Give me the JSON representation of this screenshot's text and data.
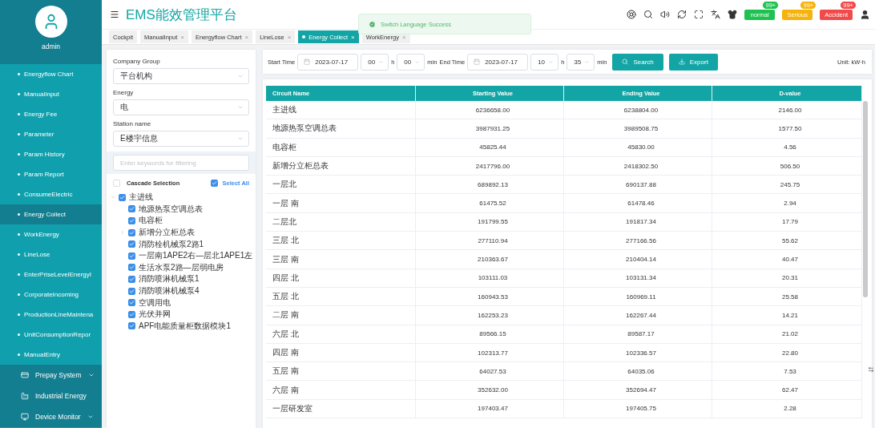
{
  "app": {
    "title": "EMS能效管理平台",
    "user": "admin"
  },
  "header": {
    "alarms": [
      {
        "label": "normal",
        "count": "99+",
        "color": "#1fc151"
      },
      {
        "label": "Serious",
        "count": "99+",
        "color": "#f5b30b"
      },
      {
        "label": "Accident",
        "count": "99+",
        "color": "#f04a4a"
      }
    ]
  },
  "tabs": [
    {
      "label": "Cockpit",
      "selected": false
    },
    {
      "label": "ManualInput",
      "close": "×",
      "selected": false
    },
    {
      "label": "Energyflow Chart",
      "close": "×",
      "selected": false
    },
    {
      "label": "LineLose",
      "close": "×",
      "selected": false
    },
    {
      "label": "Energy Collect",
      "close": "×",
      "selected": true
    },
    {
      "label": "WorkEnergy",
      "close": "×",
      "selected": false
    }
  ],
  "toast": {
    "message": "Switch Language Success"
  },
  "sidebar": {
    "items": [
      {
        "label": "Energyflow Chart",
        "selected": false
      },
      {
        "label": "ManualInput",
        "selected": false
      },
      {
        "label": "Energy Fee",
        "selected": false
      },
      {
        "label": "Parameter",
        "selected": false
      },
      {
        "label": "Param History",
        "selected": false
      },
      {
        "label": "Param Report",
        "selected": false
      },
      {
        "label": "ConsumeElectric",
        "selected": false
      },
      {
        "label": "Energy Collect",
        "selected": true
      },
      {
        "label": "WorkEnergy",
        "selected": false
      },
      {
        "label": "LineLose",
        "selected": false
      },
      {
        "label": "EnterPriseLevelEnergyI",
        "selected": false
      },
      {
        "label": "CorporateIncoming",
        "selected": false
      },
      {
        "label": "ProductionLineMaintena",
        "selected": false
      },
      {
        "label": "UnitConsumptionRepor",
        "selected": false
      },
      {
        "label": "ManualEntry",
        "selected": false
      }
    ],
    "groups": [
      {
        "label": "Prepay System",
        "kind": "expandable"
      },
      {
        "label": "Industrial Energy",
        "kind": "plain"
      },
      {
        "label": "Device Monitor",
        "kind": "expandable"
      }
    ]
  },
  "filters": {
    "company_group": {
      "label": "Company Group",
      "value": "平台机构"
    },
    "energy": {
      "label": "Energy",
      "value": "电"
    },
    "station": {
      "label": "Station name",
      "value": "E楼宇信息"
    },
    "search": {
      "placeholder": "Enter keywords for filtering"
    },
    "cascade": {
      "label": "Cascade Selection",
      "checked": false
    },
    "select_all": {
      "label": "Select All",
      "checked": true
    }
  },
  "tree": [
    {
      "label": "主进线",
      "checked": true,
      "expanded": true,
      "children": [
        {
          "label": "地源热泵空调总表",
          "checked": true
        },
        {
          "label": "电容柜",
          "checked": true
        },
        {
          "label": "新增分立柜总表",
          "checked": true,
          "expanded": false
        },
        {
          "label": "消防栓机械泵2路1",
          "checked": true
        },
        {
          "label": "一层南1APE2右—层北1APE1左",
          "checked": true
        },
        {
          "label": "生活水泵2路—层弱电房",
          "checked": true
        },
        {
          "label": "消防喷淋机械泵1",
          "checked": true
        },
        {
          "label": "消防喷淋机械泵4",
          "checked": true
        },
        {
          "label": "空调用电",
          "checked": true
        },
        {
          "label": "光伏并网",
          "checked": true
        },
        {
          "label": "APF电能质量柜数据模块1",
          "checked": true
        }
      ]
    }
  ],
  "query": {
    "start_label": "Start Time",
    "start_date": "2023-07-17",
    "start_hour": "00",
    "h1": "h",
    "start_min": "00",
    "min1": "min",
    "end_label": "End Time",
    "end_date": "2023-07-17",
    "end_hour": "10",
    "h2": "h",
    "end_min": "35",
    "min2": "min",
    "search_button": "Search",
    "export_button": "Export",
    "unit": "Unit:  kW·h"
  },
  "table": {
    "columns": [
      "Circuit Name",
      "Starting Value",
      "Ending Value",
      "D-value"
    ],
    "rows": [
      [
        "主进线",
        "6236658.00",
        "6238804.00",
        "2146.00"
      ],
      [
        "地源热泵空调总表",
        "3987931.25",
        "3989508.75",
        "1577.50"
      ],
      [
        "电容柜",
        "45825.44",
        "45830.00",
        "4.56"
      ],
      [
        "新增分立柜总表",
        "2417796.00",
        "2418302.50",
        "506.50"
      ],
      [
        "一层北",
        "689892.13",
        "690137.88",
        "245.75"
      ],
      [
        "一层 南",
        "61475.52",
        "61478.46",
        "2.94"
      ],
      [
        "二层北",
        "191799.55",
        "191817.34",
        "17.79"
      ],
      [
        "三层 北",
        "277110.94",
        "277166.56",
        "55.62"
      ],
      [
        "三层 南",
        "210363.67",
        "210404.14",
        "40.47"
      ],
      [
        "四层 北",
        "103111.03",
        "103131.34",
        "20.31"
      ],
      [
        "五层 北",
        "160943.53",
        "160969.11",
        "25.58"
      ],
      [
        "二层 南",
        "162253.23",
        "162267.44",
        "14.21"
      ],
      [
        "六层 北",
        "89566.15",
        "89587.17",
        "21.02"
      ],
      [
        "四层 南",
        "102313.77",
        "102336.57",
        "22.80"
      ],
      [
        "五层 南",
        "64027.53",
        "64035.06",
        "7.53"
      ],
      [
        "六层 南",
        "352632.00",
        "352694.47",
        "62.47"
      ],
      [
        "一层研发室",
        "197403.47",
        "197405.75",
        "2.28"
      ]
    ]
  }
}
